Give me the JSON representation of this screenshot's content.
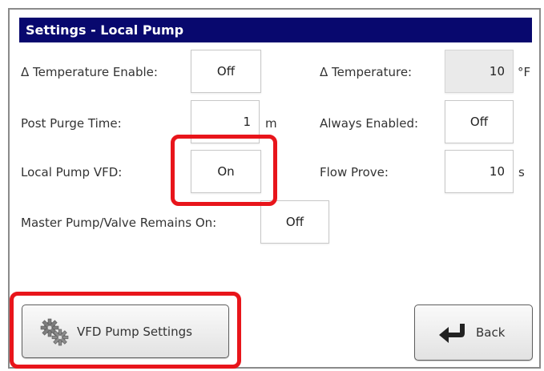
{
  "title": "Settings - Local Pump",
  "colors": {
    "titlebar": "#08086e",
    "highlight": "#e8151b"
  },
  "rows": {
    "delta_temp_enable": {
      "label": "Δ Temperature Enable:",
      "value": "Off"
    },
    "delta_temperature": {
      "label": "Δ Temperature:",
      "value": "10",
      "unit": "°F"
    },
    "post_purge_time": {
      "label": "Post Purge Time:",
      "value": "1",
      "unit": "m"
    },
    "always_enabled": {
      "label": "Always Enabled:",
      "value": "Off"
    },
    "local_pump_vfd": {
      "label": "Local Pump VFD:",
      "value": "On"
    },
    "flow_prove": {
      "label": "Flow Prove:",
      "value": "10",
      "unit": "s"
    },
    "master_pump_valve": {
      "label": "Master Pump/Valve Remains On:",
      "value": "Off"
    }
  },
  "buttons": {
    "vfd_pump_settings": {
      "label": "VFD Pump Settings",
      "icon": "gears-icon"
    },
    "back": {
      "label": "Back",
      "icon": "back-arrow-icon"
    }
  }
}
